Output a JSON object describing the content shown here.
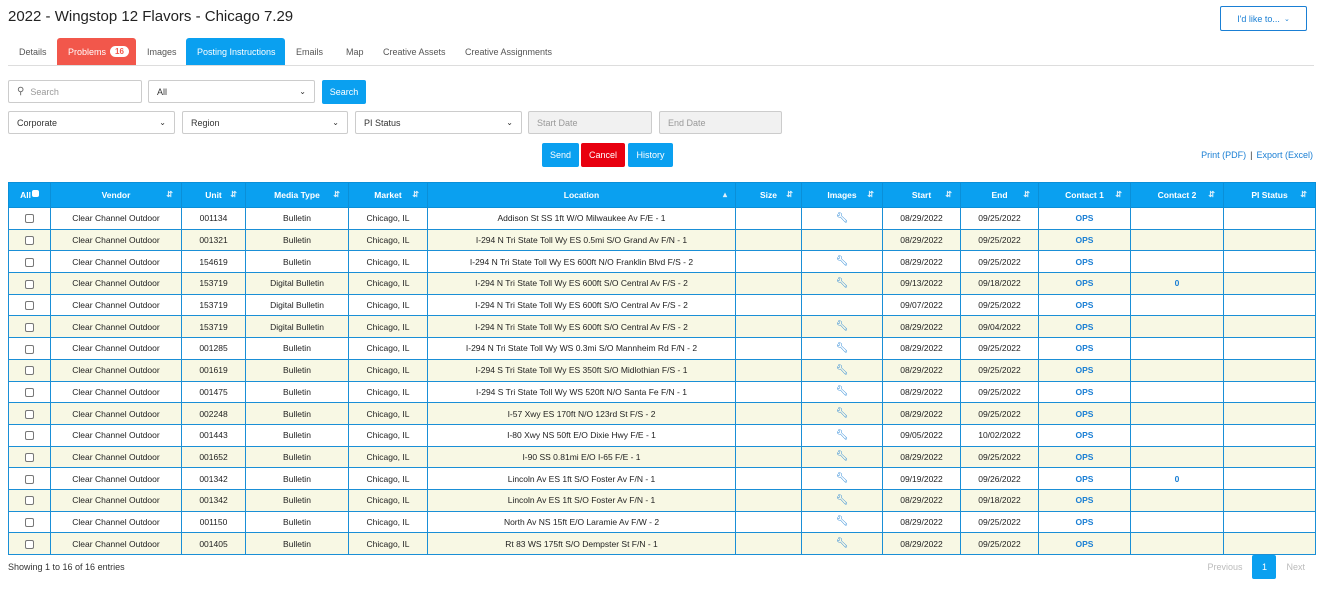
{
  "header": {
    "title": "2022 - Wingstop 12 Flavors - Chicago 7.29",
    "action_label": "I'd like to..."
  },
  "tabs": [
    {
      "label": "Details"
    },
    {
      "label": "Problems",
      "badge": "16"
    },
    {
      "label": "Images"
    },
    {
      "label": "Posting Instructions"
    },
    {
      "label": "Emails"
    },
    {
      "label": "Map"
    },
    {
      "label": "Creative Assets"
    },
    {
      "label": "Creative Assignments"
    }
  ],
  "filters": {
    "search_placeholder": "Search",
    "scope_value": "All",
    "search_button": "Search",
    "corporate_value": "Corporate",
    "region_value": "Region",
    "pi_status_value": "PI Status",
    "start_date_placeholder": "Start Date",
    "end_date_placeholder": "End Date"
  },
  "actions": {
    "send": "Send",
    "cancel": "Cancel",
    "history": "History",
    "print": "Print (PDF)",
    "sep": "|",
    "export": "Export (Excel)"
  },
  "columns": [
    "All",
    "Vendor",
    "Unit",
    "Media Type",
    "Market",
    "Location",
    "Size",
    "Images",
    "Start",
    "End",
    "Contact 1",
    "Contact 2",
    "PI Status"
  ],
  "rows": [
    {
      "vendor": "Clear Channel Outdoor",
      "unit": "001134",
      "media": "Bulletin",
      "market": "Chicago, IL",
      "location": "Addison St SS 1ft W/O Milwaukee Av F/E - 1",
      "images": true,
      "start": "08/29/2022",
      "end": "09/25/2022",
      "c1": "OPS",
      "c2": ""
    },
    {
      "vendor": "Clear Channel Outdoor",
      "unit": "001321",
      "media": "Bulletin",
      "market": "Chicago, IL",
      "location": "I-294 N Tri State Toll Wy ES 0.5mi S/O Grand Av F/N - 1",
      "images": false,
      "start": "08/29/2022",
      "end": "09/25/2022",
      "c1": "OPS",
      "c2": ""
    },
    {
      "vendor": "Clear Channel Outdoor",
      "unit": "154619",
      "media": "Bulletin",
      "market": "Chicago, IL",
      "location": "I-294 N Tri State Toll Wy ES 600ft N/O Franklin Blvd F/S - 2",
      "images": true,
      "start": "08/29/2022",
      "end": "09/25/2022",
      "c1": "OPS",
      "c2": ""
    },
    {
      "vendor": "Clear Channel Outdoor",
      "unit": "153719",
      "media": "Digital Bulletin",
      "market": "Chicago, IL",
      "location": "I-294 N Tri State Toll Wy ES 600ft S/O Central Av F/S - 2",
      "images": true,
      "start": "09/13/2022",
      "end": "09/18/2022",
      "c1": "OPS",
      "c2": "0"
    },
    {
      "vendor": "Clear Channel Outdoor",
      "unit": "153719",
      "media": "Digital Bulletin",
      "market": "Chicago, IL",
      "location": "I-294 N Tri State Toll Wy ES 600ft S/O Central Av F/S - 2",
      "images": false,
      "start": "09/07/2022",
      "end": "09/25/2022",
      "c1": "OPS",
      "c2": ""
    },
    {
      "vendor": "Clear Channel Outdoor",
      "unit": "153719",
      "media": "Digital Bulletin",
      "market": "Chicago, IL",
      "location": "I-294 N Tri State Toll Wy ES 600ft S/O Central Av F/S - 2",
      "images": true,
      "start": "08/29/2022",
      "end": "09/04/2022",
      "c1": "OPS",
      "c2": ""
    },
    {
      "vendor": "Clear Channel Outdoor",
      "unit": "001285",
      "media": "Bulletin",
      "market": "Chicago, IL",
      "location": "I-294 N Tri State Toll Wy WS 0.3mi S/O Mannheim Rd F/N - 2",
      "images": true,
      "start": "08/29/2022",
      "end": "09/25/2022",
      "c1": "OPS",
      "c2": ""
    },
    {
      "vendor": "Clear Channel Outdoor",
      "unit": "001619",
      "media": "Bulletin",
      "market": "Chicago, IL",
      "location": "I-294 S Tri State Toll Wy ES 350ft S/O Midlothian F/S - 1",
      "images": true,
      "start": "08/29/2022",
      "end": "09/25/2022",
      "c1": "OPS",
      "c2": ""
    },
    {
      "vendor": "Clear Channel Outdoor",
      "unit": "001475",
      "media": "Bulletin",
      "market": "Chicago, IL",
      "location": "I-294 S Tri State Toll Wy WS 520ft N/O Santa Fe F/N - 1",
      "images": true,
      "start": "08/29/2022",
      "end": "09/25/2022",
      "c1": "OPS",
      "c2": ""
    },
    {
      "vendor": "Clear Channel Outdoor",
      "unit": "002248",
      "media": "Bulletin",
      "market": "Chicago, IL",
      "location": "I-57 Xwy ES 170ft N/O 123rd St F/S - 2",
      "images": true,
      "start": "08/29/2022",
      "end": "09/25/2022",
      "c1": "OPS",
      "c2": ""
    },
    {
      "vendor": "Clear Channel Outdoor",
      "unit": "001443",
      "media": "Bulletin",
      "market": "Chicago, IL",
      "location": "I-80 Xwy NS 50ft E/O Dixie Hwy F/E - 1",
      "images": true,
      "start": "09/05/2022",
      "end": "10/02/2022",
      "c1": "OPS",
      "c2": ""
    },
    {
      "vendor": "Clear Channel Outdoor",
      "unit": "001652",
      "media": "Bulletin",
      "market": "Chicago, IL",
      "location": "I-90 SS 0.81mi E/O I-65 F/E - 1",
      "images": true,
      "start": "08/29/2022",
      "end": "09/25/2022",
      "c1": "OPS",
      "c2": ""
    },
    {
      "vendor": "Clear Channel Outdoor",
      "unit": "001342",
      "media": "Bulletin",
      "market": "Chicago, IL",
      "location": "Lincoln Av ES 1ft S/O Foster Av F/N - 1",
      "images": true,
      "start": "09/19/2022",
      "end": "09/26/2022",
      "c1": "OPS",
      "c2": "0"
    },
    {
      "vendor": "Clear Channel Outdoor",
      "unit": "001342",
      "media": "Bulletin",
      "market": "Chicago, IL",
      "location": "Lincoln Av ES 1ft S/O Foster Av F/N - 1",
      "images": true,
      "start": "08/29/2022",
      "end": "09/18/2022",
      "c1": "OPS",
      "c2": ""
    },
    {
      "vendor": "Clear Channel Outdoor",
      "unit": "001150",
      "media": "Bulletin",
      "market": "Chicago, IL",
      "location": "North Av NS 15ft E/O Laramie Av F/W - 2",
      "images": true,
      "start": "08/29/2022",
      "end": "09/25/2022",
      "c1": "OPS",
      "c2": ""
    },
    {
      "vendor": "Clear Channel Outdoor",
      "unit": "001405",
      "media": "Bulletin",
      "market": "Chicago, IL",
      "location": "Rt 83 WS 175ft S/O Dempster St F/N - 1",
      "images": true,
      "start": "08/29/2022",
      "end": "09/25/2022",
      "c1": "OPS",
      "c2": ""
    }
  ],
  "footer": {
    "info": "Showing 1 to 16 of 16 entries",
    "previous": "Previous",
    "page": "1",
    "next": "Next"
  },
  "colors": {
    "accent": "#0aa0f0",
    "danger": "#e8000f",
    "problems": "#f2574b",
    "alt_row": "#f8f8e4"
  }
}
